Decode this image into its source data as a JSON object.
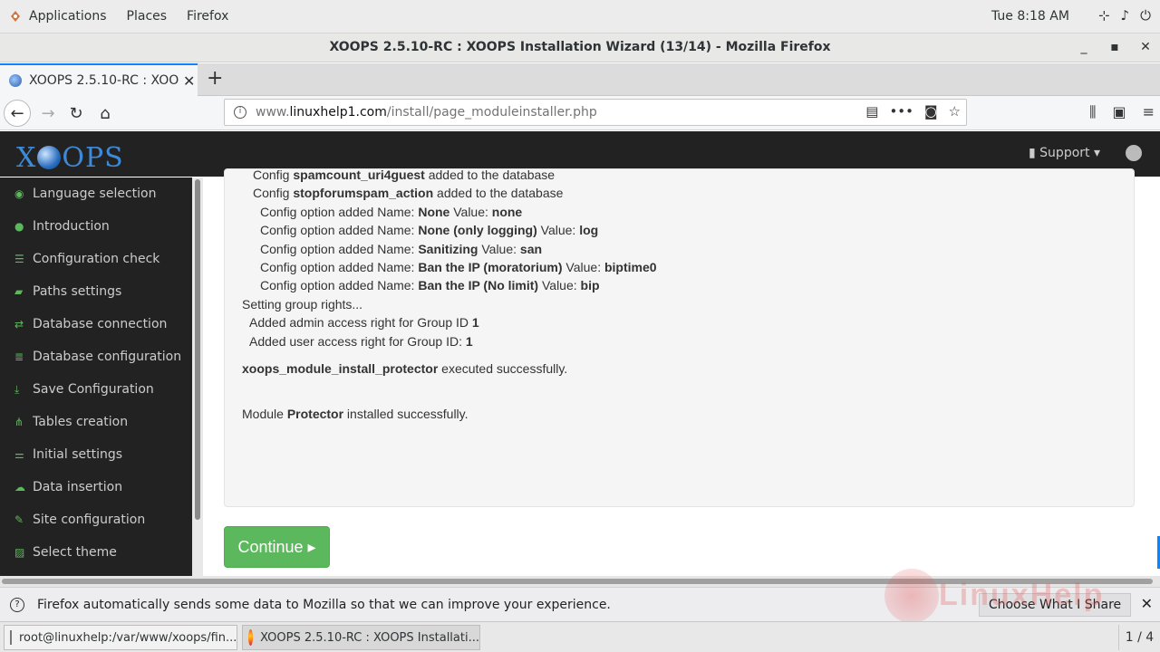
{
  "topbar": {
    "applications": "Applications",
    "places": "Places",
    "firefox": "Firefox",
    "clock": "Tue  8:18 AM"
  },
  "window": {
    "title": "XOOPS 2.5.10-RC : XOOPS Installation Wizard (13/14) - Mozilla Firefox"
  },
  "tab": {
    "title": "XOOPS 2.5.10-RC : XOOPS"
  },
  "urlbar": {
    "prefix": "www.",
    "domain": "linuxhelp1.com",
    "path": "/install/page_moduleinstaller.php"
  },
  "header": {
    "logo_left": "X",
    "logo_right": "OPS",
    "support": "Support ▾"
  },
  "sidebar": {
    "items": [
      {
        "label": "Language selection",
        "icon": "language-icon"
      },
      {
        "label": "Introduction",
        "icon": "info-icon"
      },
      {
        "label": "Configuration check",
        "icon": "list-icon"
      },
      {
        "label": "Paths settings",
        "icon": "folder-icon"
      },
      {
        "label": "Database connection",
        "icon": "connection-icon"
      },
      {
        "label": "Database configuration",
        "icon": "database-icon"
      },
      {
        "label": "Save Configuration",
        "icon": "download-icon"
      },
      {
        "label": "Tables creation",
        "icon": "sitemap-icon"
      },
      {
        "label": "Initial settings",
        "icon": "sliders-icon"
      },
      {
        "label": "Data insertion",
        "icon": "cloud-upload-icon"
      },
      {
        "label": "Site configuration",
        "icon": "edit-icon"
      },
      {
        "label": "Select theme",
        "icon": "image-icon"
      }
    ]
  },
  "log": {
    "l1_pre": "Config ",
    "l1_b": "spamcount_uri4guest",
    "l1_post": " added to the database",
    "l2_pre": "Config ",
    "l2_b": "stopforumspam_action",
    "l2_post": " added to the database",
    "opt_name_label": "Config option added Name: ",
    "value_label": " Value: ",
    "opts": [
      {
        "name": "None",
        "value": "none"
      },
      {
        "name": "None (only logging)",
        "value": "log"
      },
      {
        "name": "Sanitizing",
        "value": "san"
      },
      {
        "name": "Ban the IP (moratorium)",
        "value": "biptime0"
      },
      {
        "name": "Ban the IP (No limit)",
        "value": "bip"
      }
    ],
    "setting_rights": "Setting group rights...",
    "admin_right": "Added admin access right for Group ID ",
    "admin_id": "1",
    "user_right": "Added user access right for Group ID: ",
    "user_id": "1",
    "exec_b": "xoops_module_install_protector",
    "exec_post": " executed successfully.",
    "mod_pre": "Module ",
    "mod_b": "Protector",
    "mod_post": " installed successfully."
  },
  "continue_label": "Continue ▸",
  "notification": {
    "text": "Firefox automatically sends some data to Mozilla so that we can improve your experience.",
    "button": "Choose What I Share"
  },
  "watermark": "LinuxHelp",
  "taskbar": {
    "terminal": "root@linuxhelp:/var/www/xoops/fin...",
    "firefox": "XOOPS 2.5.10-RC : XOOPS Installati...",
    "pager": "1 / 4"
  }
}
